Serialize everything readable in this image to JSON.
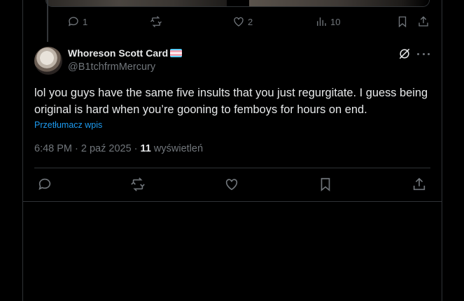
{
  "parent_tweet": {
    "actions": {
      "reply_count": "1",
      "repost_count": "",
      "like_count": "2",
      "view_count": "10"
    }
  },
  "reply_tweet": {
    "author": {
      "display_name": "Whoreson Scott Card",
      "flag_icon": "transgender-flag-icon",
      "handle": "@B1tchfrmMercury"
    },
    "text": "lol you guys have the same five insults that you just regurgitate. I guess being original is hard when you’re gooning to femboys for hours on end.",
    "translate_label": "Przetłumacz wpis",
    "timestamp": "6:48 PM · 2 paź 2025 · ",
    "views_count": "11",
    "views_label": " wyświetleń"
  },
  "colors": {
    "background": "#000000",
    "text": "#e7e9ea",
    "muted": "#71767b",
    "link": "#1d9bf0",
    "border": "#2f3336"
  }
}
